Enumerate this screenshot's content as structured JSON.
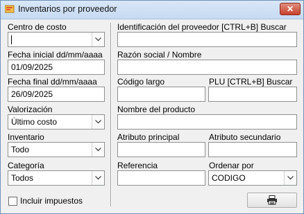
{
  "window": {
    "title": "Inventarios por proveedor",
    "close_icon": "close-icon",
    "app_icon": "app-icon",
    "accent": "#c7412b"
  },
  "left": {
    "centro_costo": {
      "label": "Centro de costo",
      "value": ""
    },
    "fecha_inicial": {
      "label": "Fecha inicial dd/mm/aaaa",
      "value": "01/09/2025"
    },
    "fecha_final": {
      "label": "Fecha final dd/mm/aaaa",
      "value": "26/09/2025"
    },
    "valorizacion": {
      "label": "Valorización",
      "value": "Último costo"
    },
    "inventario": {
      "label": "Inventario",
      "value": "Todo"
    },
    "categoria": {
      "label": "Categoría",
      "value": "Todos"
    },
    "incluir_impuestos": {
      "label": "Incluir impuestos",
      "checked": false
    }
  },
  "right": {
    "id_proveedor": {
      "label": "Identificación del proveedor [CTRL+B] Buscar",
      "value": ""
    },
    "razon_social": {
      "label": "Razón social / Nombre",
      "value": ""
    },
    "codigo_largo": {
      "label": "Código largo",
      "value": ""
    },
    "plu": {
      "label": "PLU [CTRL+B] Buscar",
      "value": ""
    },
    "nombre_producto": {
      "label": "Nombre del producto",
      "value": ""
    },
    "atributo_principal": {
      "label": "Atributo principal",
      "value": ""
    },
    "atributo_secundario": {
      "label": "Atributo secundario",
      "value": ""
    },
    "referencia": {
      "label": "Referencia",
      "value": ""
    },
    "ordenar_por": {
      "label": "Ordenar por",
      "value": "CODIGO"
    }
  },
  "actions": {
    "print_icon": "printer-icon"
  }
}
